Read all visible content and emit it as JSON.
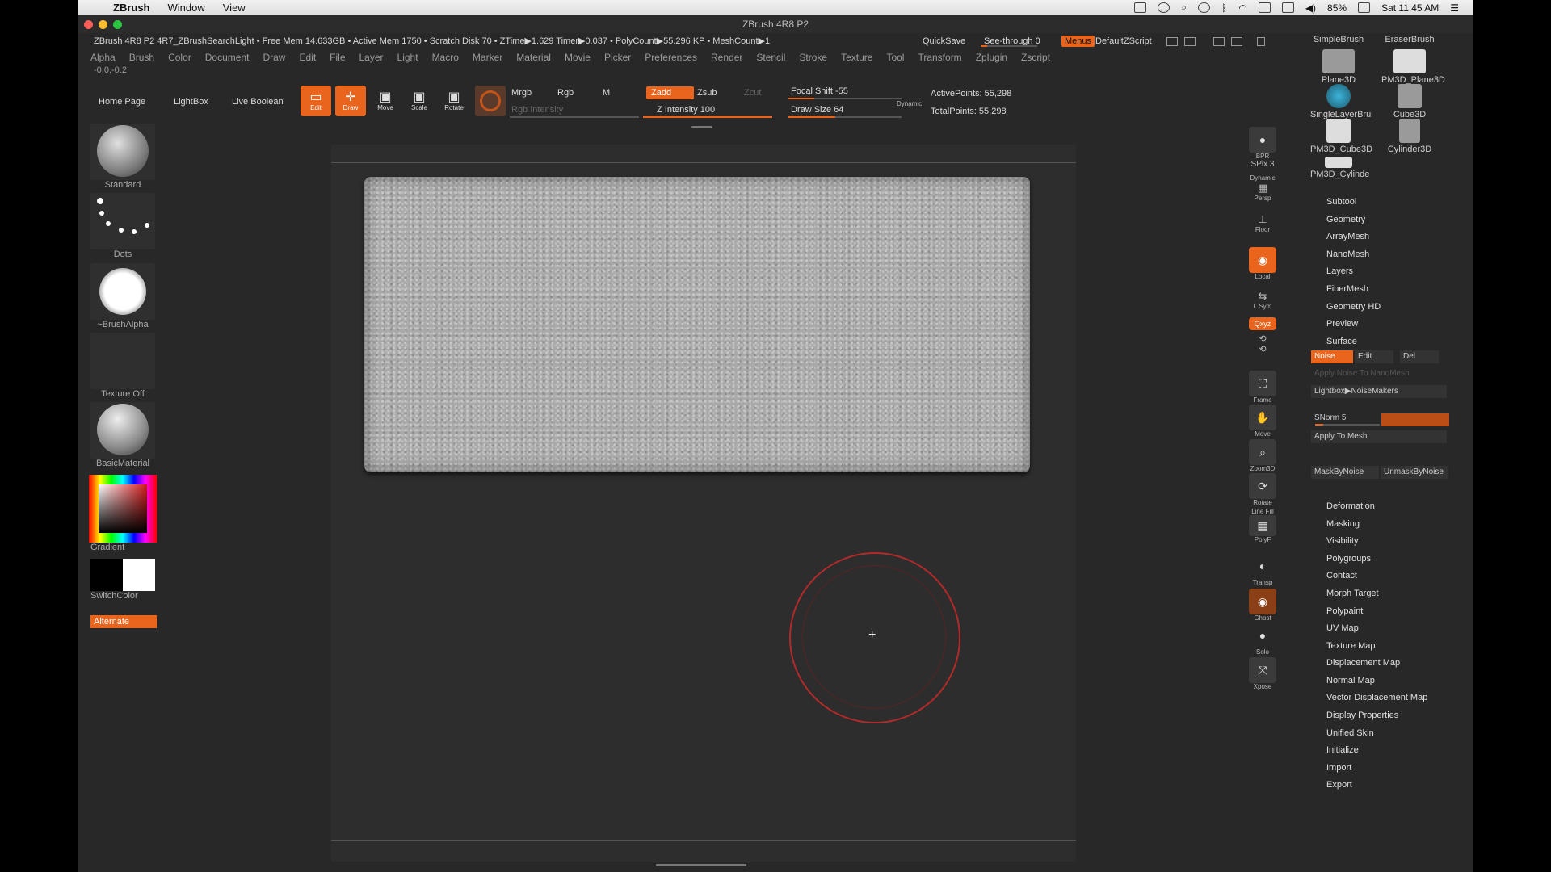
{
  "mac_menubar": {
    "apple": "",
    "app_name": "ZBrush",
    "menus": [
      "Window",
      "View"
    ],
    "battery": "85%",
    "clock": "Sat 11:45 AM"
  },
  "window": {
    "title": "ZBrush 4R8 P2"
  },
  "infobar": {
    "text": "ZBrush 4R8 P2 4R7_ZBrushSearchLight  • Free Mem 14.633GB • Active Mem 1750 • Scratch Disk 70 •  ZTime▶1.629 Timer▶0.037 • PolyCount▶55.296 KP  • MeshCount▶1",
    "quicksave": "QuickSave",
    "see_through": "See-through  0",
    "menus_label": "Menus",
    "script_label": "DefaultZScript"
  },
  "main_menu": [
    "Alpha",
    "Brush",
    "Color",
    "Document",
    "Draw",
    "Edit",
    "File",
    "Layer",
    "Light",
    "Macro",
    "Marker",
    "Material",
    "Movie",
    "Picker",
    "Preferences",
    "Render",
    "Stencil",
    "Stroke",
    "Texture",
    "Tool",
    "Transform",
    "Zplugin",
    "Zscript"
  ],
  "coords": "-0,0,-0.2",
  "toolbar": {
    "home_page": "Home Page",
    "lightbox": "LightBox",
    "live_boolean": "Live Boolean",
    "edit": "Edit",
    "draw": "Draw",
    "move": "Move",
    "scale": "Scale",
    "rotate": "Rotate",
    "mrgb": "Mrgb",
    "rgb": "Rgb",
    "m": "M",
    "rgb_intensity": "Rgb Intensity",
    "zadd": "Zadd",
    "zsub": "Zsub",
    "zcut": "Zcut",
    "z_intensity": "Z Intensity 100",
    "focal_shift": "Focal Shift -55",
    "draw_size": "Draw Size 64",
    "dynamic": "Dynamic",
    "active_points": "ActivePoints: 55,298",
    "total_points": "TotalPoints: 55,298",
    "z_intensity_value": 100,
    "focal_shift_value": -55,
    "draw_size_value": 64
  },
  "left_shelf": {
    "brush": "Standard",
    "stroke": "Dots",
    "alpha": "~BrushAlpha",
    "texture": "Texture Off",
    "material": "BasicMaterial",
    "gradient": "Gradient",
    "switch_color": "SwitchColor",
    "alternate": "Alternate"
  },
  "right_strip": {
    "bpr": "BPR",
    "spix": "SPix 3",
    "dynamic": "Dynamic",
    "persp": "Persp",
    "floor": "Floor",
    "local": "Local",
    "lsym": "L.Sym",
    "xyz": "Qxyz",
    "frame": "Frame",
    "move": "Move",
    "zoom3d": "Zoom3D",
    "rotate": "Rotate",
    "linefill": "Line Fill",
    "polyf": "PolyF",
    "transp": "Transp",
    "ghost": "Ghost",
    "solo": "Solo",
    "xpose": "Xpose"
  },
  "tool_palette": {
    "top_labels": [
      "SimpleBrush",
      "EraserBrush"
    ],
    "thumbs": [
      "Plane3D",
      "PM3D_Plane3D",
      "SingleLayerBru",
      "Cube3D",
      "PM3D_Cube3D",
      "Cylinder3D",
      "PM3D_Cylinde"
    ],
    "items_top": [
      "Subtool",
      "Geometry",
      "ArrayMesh",
      "NanoMesh",
      "Layers",
      "FiberMesh",
      "Geometry HD",
      "Preview",
      "Surface"
    ],
    "noise": "Noise",
    "edit": "Edit",
    "del": "Del",
    "apply_noise_nanomesh": "Apply Noise To NanoMesh",
    "lightbox_noisemakers": "Lightbox▶NoiseMakers",
    "snorm": "SNorm 5",
    "apply_to_mesh": "Apply To Mesh",
    "mask_by_noise": "MaskByNoise",
    "unmask_by_noise": "UnmaskByNoise",
    "items_bottom": [
      "Deformation",
      "Masking",
      "Visibility",
      "Polygroups",
      "Contact",
      "Morph Target",
      "Polypaint",
      "UV Map",
      "Texture Map",
      "Displacement Map",
      "Normal Map",
      "Vector Displacement Map",
      "Display Properties",
      "Unified Skin",
      "Initialize",
      "Import",
      "Export"
    ]
  },
  "colors": {
    "accent": "#e9641c",
    "background": "#282828",
    "canvas": "#2d2d2d"
  }
}
